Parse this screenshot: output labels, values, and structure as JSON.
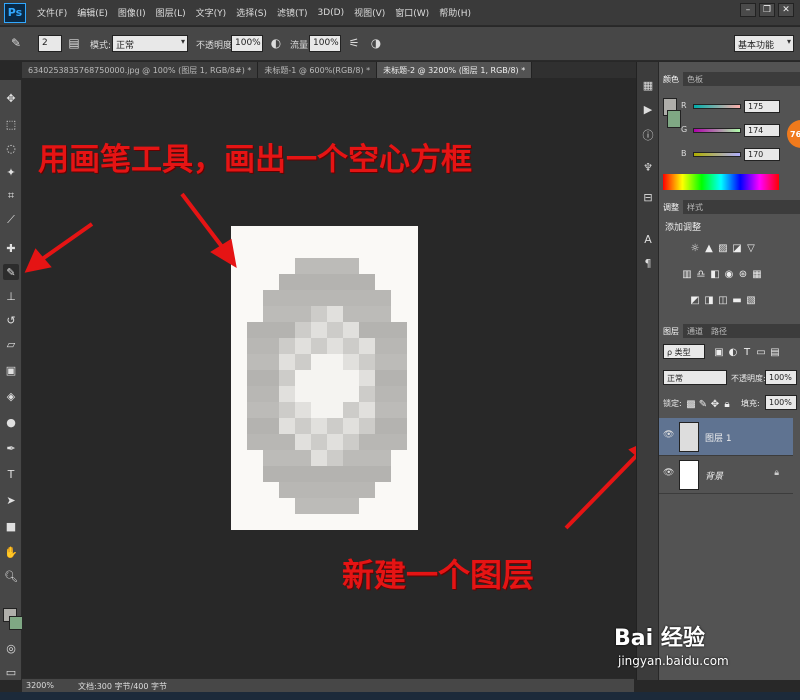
{
  "app": {
    "logo": "Ps",
    "menu": [
      "文件(F)",
      "编辑(E)",
      "图像(I)",
      "图层(L)",
      "文字(Y)",
      "选择(S)",
      "滤镜(T)",
      "3D(D)",
      "视图(V)",
      "窗口(W)",
      "帮助(H)"
    ]
  },
  "options": {
    "brush_size": "2",
    "mode_label": "模式:",
    "mode_value": "正常",
    "opacity_label": "不透明度:",
    "opacity_value": "100%",
    "flow_label": "流量:",
    "flow_value": "100%",
    "workspace": "基本功能"
  },
  "tabs": [
    {
      "label": "6340253835768750000.jpg @ 100% (图层 1, RGB/8#) *",
      "active": false
    },
    {
      "label": "未标题-1 @ 600%(RGB/8) *",
      "active": false
    },
    {
      "label": "未标题-2 @ 3200% (图层 1, RGB/8) *",
      "active": true
    }
  ],
  "annotations": {
    "top_text": "用画笔工具，画出一个空心方框",
    "bottom_text": "新建一个图层"
  },
  "color_panel": {
    "tabs": [
      "颜色",
      "色板"
    ],
    "r_label": "R",
    "r_value": "175",
    "g_label": "G",
    "g_value": "174",
    "b_label": "B",
    "b_value": "170",
    "foreground": "#afaeaa",
    "background": "#ffffff",
    "badge": "76"
  },
  "adjust_panel": {
    "tabs": [
      "调整",
      "样式"
    ],
    "title": "添加调整"
  },
  "layers_panel": {
    "tabs": [
      "图层",
      "通道",
      "路径"
    ],
    "filter_label": "ρ 类型",
    "blend_mode": "正常",
    "opacity_label": "不透明度:",
    "opacity_value": "100%",
    "lock_label": "锁定:",
    "fill_label": "填充:",
    "fill_value": "100%",
    "layers": [
      {
        "name": "图层 1",
        "active": true
      },
      {
        "name": "背景",
        "active": false,
        "locked": true
      }
    ]
  },
  "status": {
    "zoom": "3200%",
    "doc_info": "文档:300 字节/400 字节"
  },
  "watermark": {
    "logo": "Bai 经验",
    "url": "jingyan.baidu.com"
  }
}
